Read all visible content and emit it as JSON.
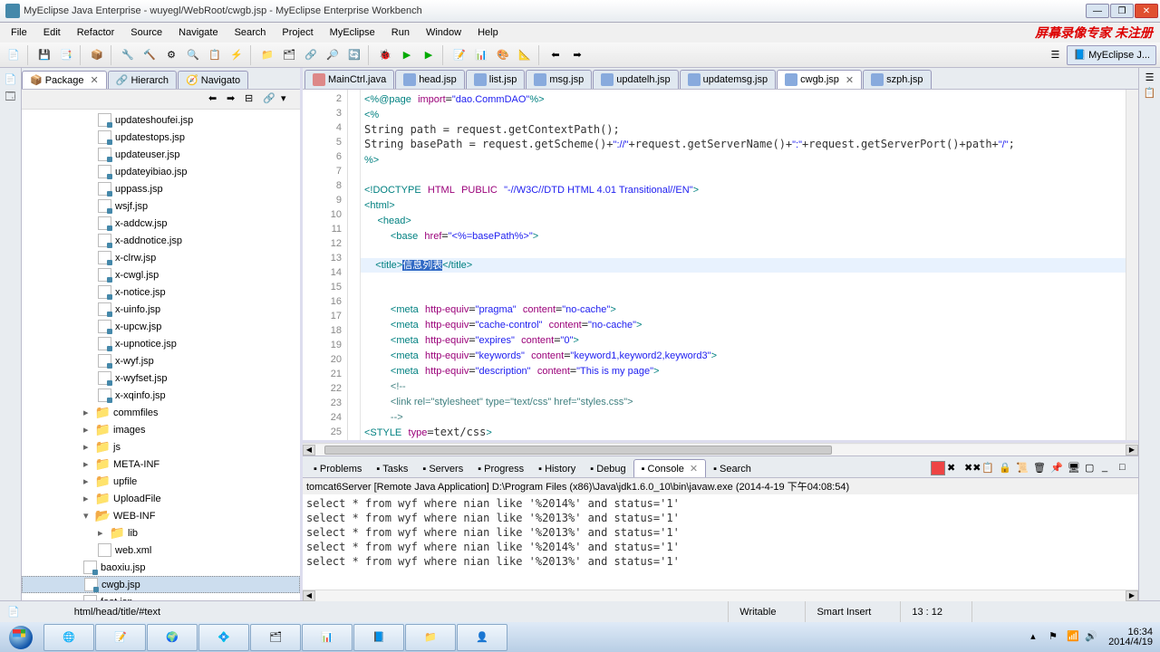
{
  "title": "MyEclipse Java Enterprise - wuyegl/WebRoot/cwgb.jsp - MyEclipse Enterprise Workbench",
  "watermark": "屏幕录像专家  未注册",
  "menu": [
    "File",
    "Edit",
    "Refactor",
    "Source",
    "Navigate",
    "Search",
    "Project",
    "MyEclipse",
    "Run",
    "Window",
    "Help"
  ],
  "perspectives": [
    {
      "label": "MyEclipse J..."
    }
  ],
  "packageTabs": [
    {
      "label": "Package",
      "active": true
    },
    {
      "label": "Hierarch",
      "active": false
    },
    {
      "label": "Navigato",
      "active": false
    }
  ],
  "tree": [
    {
      "label": "updateshoufei.jsp",
      "type": "jsp"
    },
    {
      "label": "updatestops.jsp",
      "type": "jsp"
    },
    {
      "label": "updateuser.jsp",
      "type": "jsp"
    },
    {
      "label": "updateyibiao.jsp",
      "type": "jsp"
    },
    {
      "label": "uppass.jsp",
      "type": "jsp"
    },
    {
      "label": "wsjf.jsp",
      "type": "jsp"
    },
    {
      "label": "x-addcw.jsp",
      "type": "jsp"
    },
    {
      "label": "x-addnotice.jsp",
      "type": "jsp"
    },
    {
      "label": "x-clrw.jsp",
      "type": "jsp"
    },
    {
      "label": "x-cwgl.jsp",
      "type": "jsp"
    },
    {
      "label": "x-notice.jsp",
      "type": "jsp"
    },
    {
      "label": "x-uinfo.jsp",
      "type": "jsp"
    },
    {
      "label": "x-upcw.jsp",
      "type": "jsp"
    },
    {
      "label": "x-upnotice.jsp",
      "type": "jsp"
    },
    {
      "label": "x-wyf.jsp",
      "type": "jsp"
    },
    {
      "label": "x-wyfset.jsp",
      "type": "jsp"
    },
    {
      "label": "x-xqinfo.jsp",
      "type": "jsp"
    },
    {
      "label": "commfiles",
      "type": "folder",
      "level": 1
    },
    {
      "label": "images",
      "type": "folder",
      "level": 1
    },
    {
      "label": "js",
      "type": "folder",
      "level": 1
    },
    {
      "label": "META-INF",
      "type": "folder",
      "level": 1
    },
    {
      "label": "upfile",
      "type": "folder",
      "level": 1
    },
    {
      "label": "UploadFile",
      "type": "folder",
      "level": 1
    },
    {
      "label": "WEB-INF",
      "type": "folder",
      "level": 1,
      "expanded": true
    },
    {
      "label": "lib",
      "type": "folder",
      "level": 2
    },
    {
      "label": "web.xml",
      "type": "xml",
      "level": 2
    },
    {
      "label": "baoxiu.jsp",
      "type": "jsp",
      "level": 1
    },
    {
      "label": "cwgb.jsp",
      "type": "jsp",
      "level": 1,
      "selected": true
    },
    {
      "label": "foot.isn",
      "type": "jsp",
      "level": 1
    }
  ],
  "editorTabs": [
    {
      "label": "MainCtrl.java",
      "type": "java"
    },
    {
      "label": "head.jsp",
      "type": "jsp"
    },
    {
      "label": "list.jsp",
      "type": "jsp"
    },
    {
      "label": "msg.jsp",
      "type": "jsp"
    },
    {
      "label": "updatelh.jsp",
      "type": "jsp"
    },
    {
      "label": "updatemsg.jsp",
      "type": "jsp"
    },
    {
      "label": "cwgb.jsp",
      "type": "jsp",
      "active": true,
      "close": true
    },
    {
      "label": "szph.jsp",
      "type": "jsp"
    }
  ],
  "code": {
    "startLine": 2,
    "currentLine": 13,
    "selection": "信息列表"
  },
  "bottomTabs": [
    {
      "label": "Problems"
    },
    {
      "label": "Tasks"
    },
    {
      "label": "Servers"
    },
    {
      "label": "Progress"
    },
    {
      "label": "History"
    },
    {
      "label": "Debug"
    },
    {
      "label": "Console",
      "active": true,
      "close": true
    },
    {
      "label": "Search"
    }
  ],
  "consoleTitle": "tomcat6Server [Remote Java Application] D:\\Program Files (x86)\\Java\\jdk1.6.0_10\\bin\\javaw.exe (2014-4-19 下午04:08:54)",
  "consoleLines": [
    "select * from wyf where nian like '%2014%' and status='1'",
    "select * from wyf where nian like '%2013%' and status='1'",
    "select * from wyf where nian like '%2013%' and status='1'",
    "select * from wyf where nian like '%2014%' and status='1'",
    "select * from wyf where nian like '%2013%' and status='1'"
  ],
  "statusbar": {
    "path": "html/head/title/#text",
    "writable": "Writable",
    "insert": "Smart Insert",
    "pos": "13 : 12"
  },
  "clock": {
    "time": "16:34",
    "date": "2014/4/19"
  }
}
